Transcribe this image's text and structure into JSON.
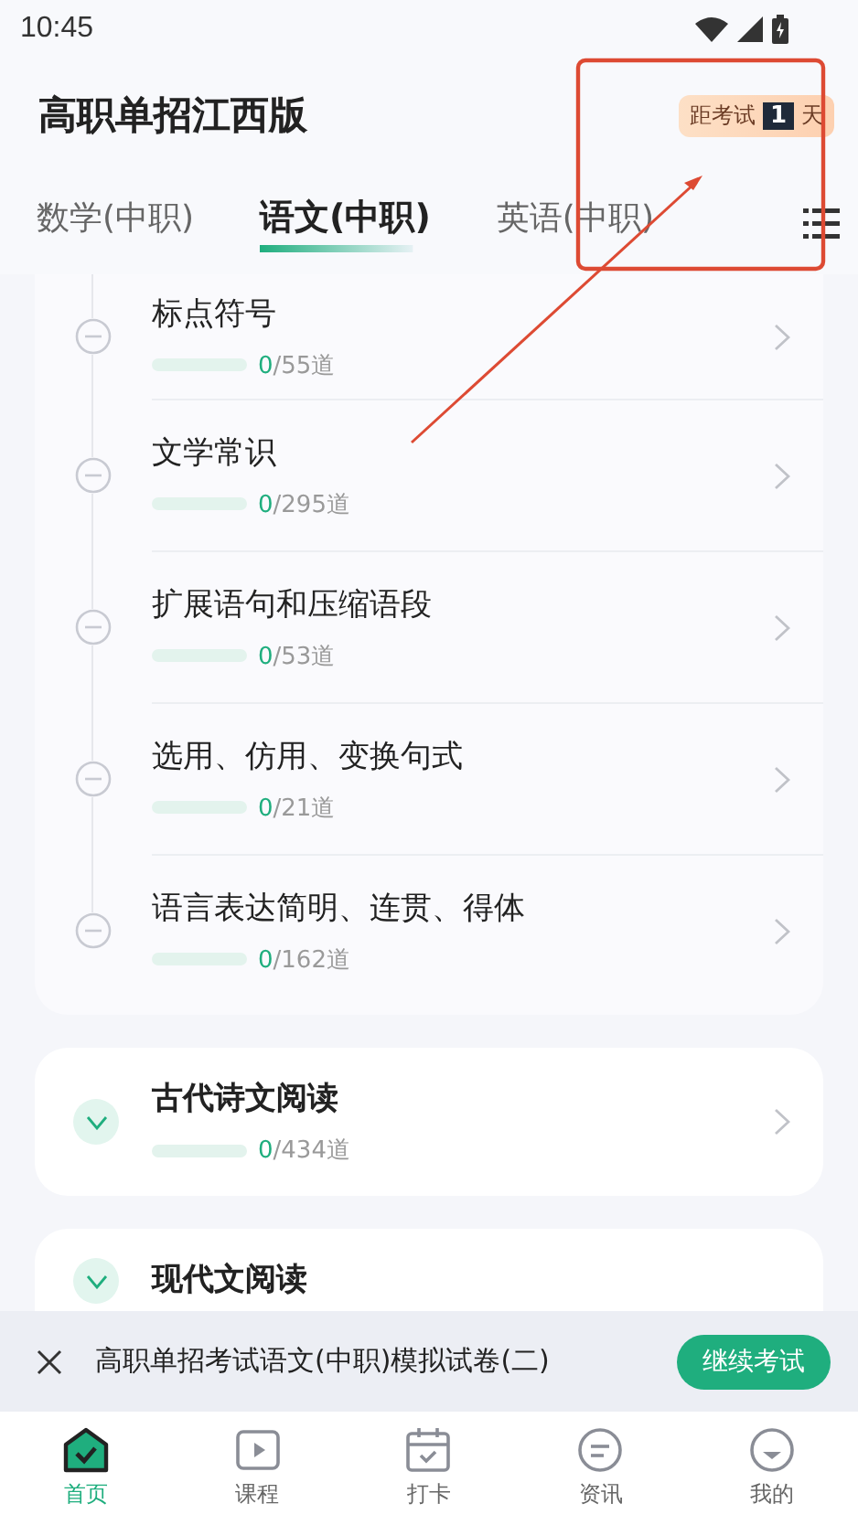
{
  "status_bar": {
    "time": "10:45"
  },
  "header": {
    "title": "高职单招江西版",
    "countdown": {
      "prefix": "距考试",
      "days": "1",
      "suffix": "天"
    }
  },
  "tabs": [
    {
      "label": "数学(中职)",
      "selected": false
    },
    {
      "label": "语文(中职)",
      "selected": true
    },
    {
      "label": "英语(中职)",
      "selected": false
    }
  ],
  "sections": [
    {
      "kind": "list",
      "items": [
        {
          "title": "标点符号",
          "done": "0",
          "total": "/55道"
        },
        {
          "title": "文学常识",
          "done": "0",
          "total": "/295道"
        },
        {
          "title": "扩展语句和压缩语段",
          "done": "0",
          "total": "/53道"
        },
        {
          "title": "选用、仿用、变换句式",
          "done": "0",
          "total": "/21道"
        },
        {
          "title": "语言表达简明、连贯、得体",
          "done": "0",
          "total": "/162道"
        }
      ]
    },
    {
      "kind": "chapter",
      "title": "古代诗文阅读",
      "done": "0",
      "total": "/434道",
      "expanded": false
    },
    {
      "kind": "chapter",
      "title": "现代文阅读",
      "expanded": false
    }
  ],
  "banner": {
    "text": "高职单招考试语文(中职)模拟试卷(二)",
    "button": "继续考试"
  },
  "nav": [
    {
      "label": "首页",
      "selected": true
    },
    {
      "label": "课程",
      "selected": false
    },
    {
      "label": "打卡",
      "selected": false
    },
    {
      "label": "资讯",
      "selected": false
    },
    {
      "label": "我的",
      "selected": false
    }
  ]
}
